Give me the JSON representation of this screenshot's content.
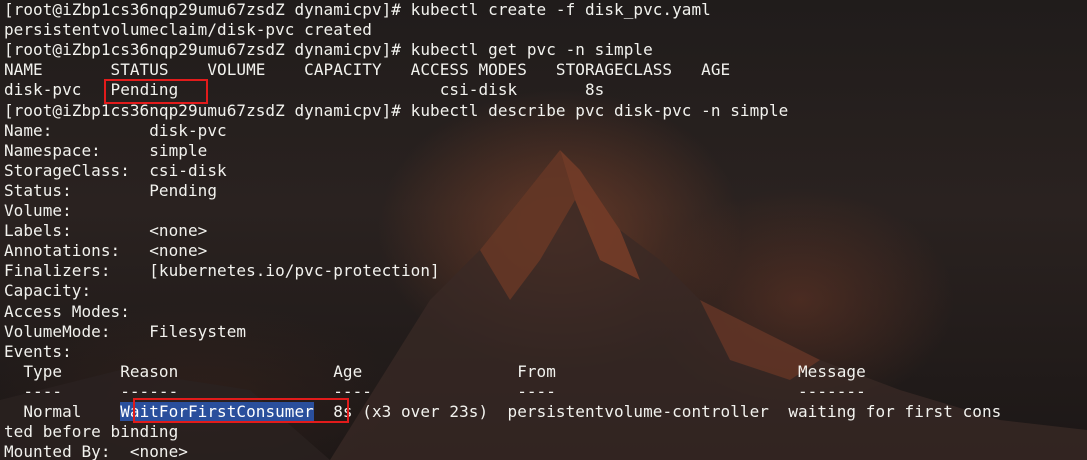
{
  "terminal": {
    "lines": [
      "[root@iZbp1cs36nqp29umu67zsdZ dynamicpv]# kubectl create -f disk_pvc.yaml",
      "persistentvolumeclaim/disk-pvc created",
      "[root@iZbp1cs36nqp29umu67zsdZ dynamicpv]# kubectl get pvc -n simple",
      "NAME       STATUS    VOLUME    CAPACITY   ACCESS MODES   STORAGECLASS   AGE",
      "disk-pvc   ",
      "[root@iZbp1cs36nqp29umu67zsdZ dynamicpv]# kubectl describe pvc disk-pvc -n simple",
      "Name:          disk-pvc",
      "Namespace:     simple",
      "StorageClass:  csi-disk",
      "Status:        Pending",
      "Volume:",
      "Labels:        <none>",
      "Annotations:   <none>",
      "Finalizers:    [kubernetes.io/pvc-protection]",
      "Capacity:",
      "Access Modes:",
      "VolumeMode:    Filesystem",
      "Events:",
      "  Type      Reason                Age                From                         Message",
      "  ----      ------                ----               ----                         -------",
      "  Normal    ",
      "ted before binding",
      "Mounted By:  <none>"
    ],
    "row4_status": "Pending",
    "row4_rest": "                           csi-disk       8s",
    "row20_reason": "WaitForFirstConsumer",
    "row20_rest": "  8s (x3 over 23s)  persistentvolume-controller  waiting for first cons"
  },
  "colors": {
    "text": "#f2f2ee",
    "highlight_box": "#e21b1b",
    "selection": "#2a4f9c"
  }
}
